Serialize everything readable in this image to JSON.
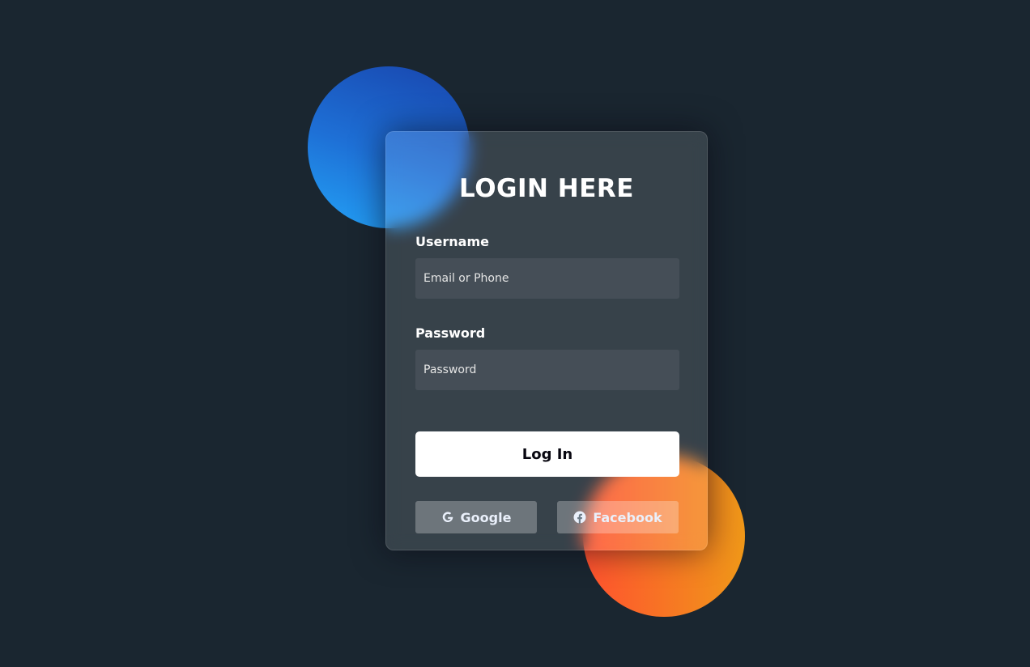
{
  "colors": {
    "background": "#1a2630",
    "blob_blue_start": "#1845ad",
    "blob_blue_end": "#23a2f6",
    "blob_orange_start": "#ff512f",
    "blob_orange_end": "#f09819",
    "button_bg": "#ffffff"
  },
  "login": {
    "title": "LOGIN HERE",
    "username_label": "Username",
    "username_placeholder": "Email or Phone",
    "password_label": "Password",
    "password_placeholder": "Password",
    "submit_label": "Log In"
  },
  "social": {
    "google": {
      "label": "Google",
      "icon": "google-icon"
    },
    "facebook": {
      "label": "Facebook",
      "icon": "facebook-icon"
    }
  }
}
